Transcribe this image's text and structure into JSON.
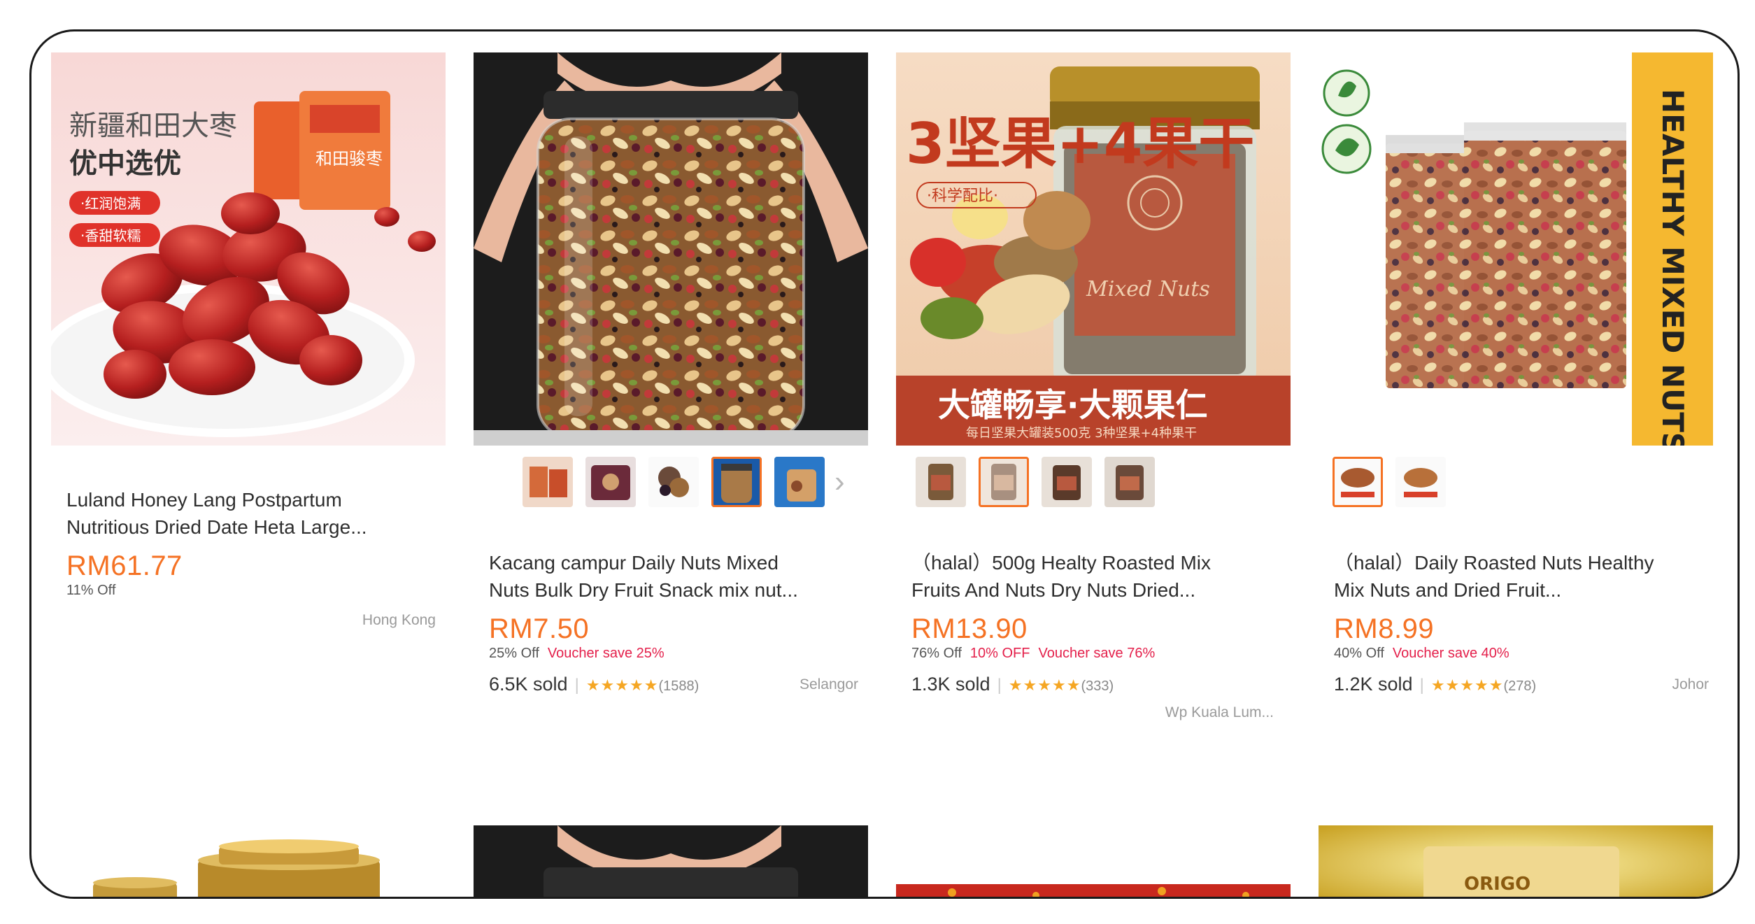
{
  "products": [
    {
      "img_text": [
        "新疆和田大枣",
        "优中选优",
        "·红润饱满",
        "·香甜软糯",
        "和田骏枣"
      ],
      "title_lines": [
        "Luland Honey Lang Postpartum",
        "Nutritious Dried Date Heta Large..."
      ],
      "price": "RM61.77",
      "discount": "11% Off",
      "location": "Hong Kong"
    },
    {
      "title_lines": [
        "Kacang campur Daily Nuts Mixed",
        "Nuts Bulk Dry Fruit Snack mix nut..."
      ],
      "price": "RM7.50",
      "discount": "25% Off",
      "vouchers": [
        "Voucher save 25%"
      ],
      "sold": "6.5K sold",
      "rating_count": "(1588)",
      "location": "Selangor"
    },
    {
      "img_text": [
        "3坚果+4果干",
        "·科学配比·",
        "Mixed Nuts",
        "大罐畅享·大颗果仁",
        "每日坚果大罐装500克 3种坚果+4种果干"
      ],
      "title_lines": [
        "（halal）500g Healty Roasted Mix",
        "Fruits And Nuts Dry Nuts Dried..."
      ],
      "price": "RM13.90",
      "discount": "76% Off",
      "vouchers": [
        "10% OFF",
        "Voucher save 76%"
      ],
      "sold": "1.3K sold",
      "rating_count": "(333)",
      "location": "Wp Kuala Lum..."
    },
    {
      "img_text": [
        "HEALTHY MIXED NUTS"
      ],
      "title_lines": [
        "（halal）Daily Roasted Nuts Healthy",
        "Mix Nuts and Dried Fruit..."
      ],
      "price": "RM8.99",
      "discount": "40% Off",
      "vouchers": [
        "Voucher save 40%"
      ],
      "sold": "1.2K sold",
      "rating_count": "(278)",
      "location": "Johor"
    }
  ],
  "stars": "★★★★★",
  "thumbnail_next_icon": "chevron-right-icon",
  "bottom_row_img_text": "ORIGO",
  "colors": {
    "price": "#f57224",
    "voucher": "#e4204b",
    "star": "#f5a623"
  }
}
